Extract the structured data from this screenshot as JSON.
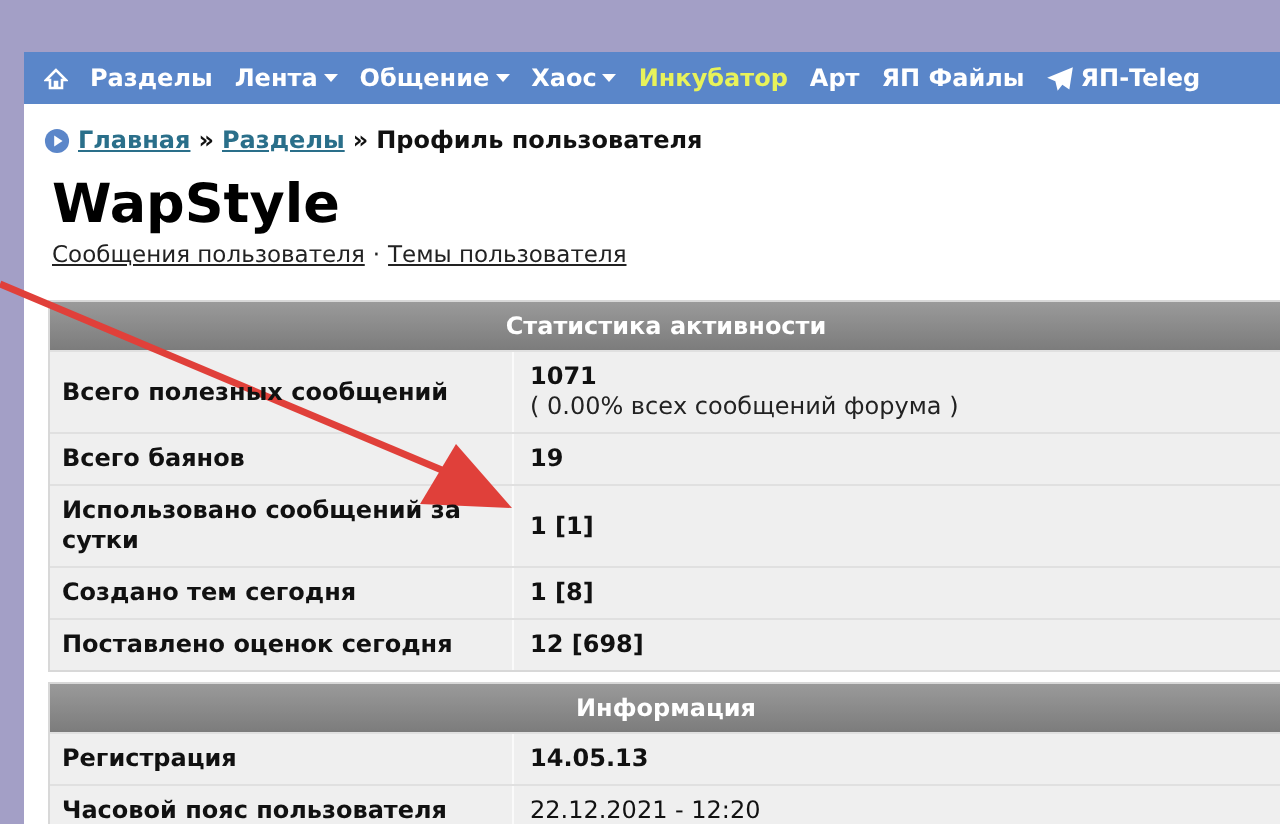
{
  "nav": {
    "items": [
      {
        "label": "Разделы",
        "dropdown": false,
        "highlighted": false,
        "kind": "text"
      },
      {
        "label": "Лента",
        "dropdown": true,
        "highlighted": false,
        "kind": "text"
      },
      {
        "label": "Общение",
        "dropdown": true,
        "highlighted": false,
        "kind": "text"
      },
      {
        "label": "Хаос",
        "dropdown": true,
        "highlighted": false,
        "kind": "text"
      },
      {
        "label": "Инкубатор",
        "dropdown": false,
        "highlighted": true,
        "kind": "text"
      },
      {
        "label": "Арт",
        "dropdown": false,
        "highlighted": false,
        "kind": "text"
      },
      {
        "label": "ЯП Файлы",
        "dropdown": false,
        "highlighted": false,
        "kind": "text"
      },
      {
        "label": "ЯП-Teleg",
        "dropdown": false,
        "highlighted": false,
        "kind": "telegram"
      }
    ]
  },
  "breadcrumb": {
    "links": [
      "Главная",
      "Разделы"
    ],
    "separator": "»",
    "current": "Профиль пользователя"
  },
  "profile": {
    "username": "WapStyle",
    "links": [
      "Сообщения пользователя",
      "Темы пользователя"
    ],
    "link_separator": "·"
  },
  "sections": [
    {
      "title": "Статистика активности",
      "rows": [
        {
          "label": "Всего полезных сообщений",
          "value": "1071",
          "note": "( 0.00% всех сообщений форума )"
        },
        {
          "label": "Всего баянов",
          "value": "19"
        },
        {
          "label": "Использовано сообщений за сутки",
          "value": "1 [1]"
        },
        {
          "label": "Создано тем сегодня",
          "value": "1 [8]"
        },
        {
          "label": "Поставлено оценок сегодня",
          "value": "12 [698]"
        }
      ]
    },
    {
      "title": "Информация",
      "rows": [
        {
          "label": "Регистрация",
          "value": "14.05.13"
        },
        {
          "label": "Часовой пояс пользователя",
          "value": "22.12.2021 - 12:20",
          "plain": true
        }
      ]
    }
  ]
}
